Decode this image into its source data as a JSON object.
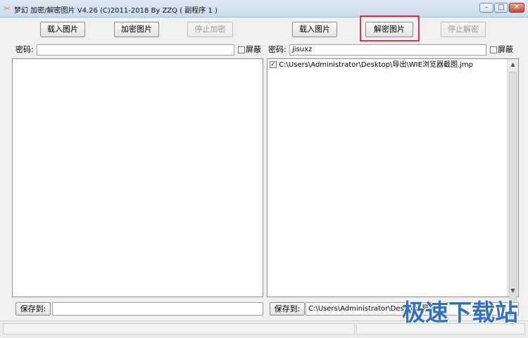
{
  "window": {
    "title": "梦幻 加密/解密图片 V4.26  (C)2011-2018 By ZZQ  ( 副程序 1 )",
    "icon": "app-icon",
    "controls": {
      "minimize": "–",
      "maximize": "□",
      "close": "✕"
    }
  },
  "left": {
    "load_label": "载入图片",
    "encrypt_label": "加密图片",
    "stop_label": "停止加密",
    "password_label": "密码:",
    "password_value": "",
    "mask_label": "屏蔽",
    "mask_checked": false,
    "save_label": "保存到:",
    "save_path": ""
  },
  "right": {
    "load_label": "载入图片",
    "decrypt_label": "解密图片",
    "stop_label": "停止解密",
    "password_label": "密码:",
    "password_value": "jisuxz",
    "mask_label": "屏蔽",
    "mask_checked": false,
    "file_items": [
      {
        "checked": true,
        "path": "C:\\Users\\Administrator\\Desktop\\导出\\WIE浏览器截图.jmp"
      }
    ],
    "save_label": "保存到:",
    "save_path": "C:\\Users\\Administrator\\Desktop\\导出"
  },
  "watermark": {
    "text": "极速下载站",
    "color": "#2f6fc8"
  },
  "colors": {
    "highlight": "#e23040"
  }
}
